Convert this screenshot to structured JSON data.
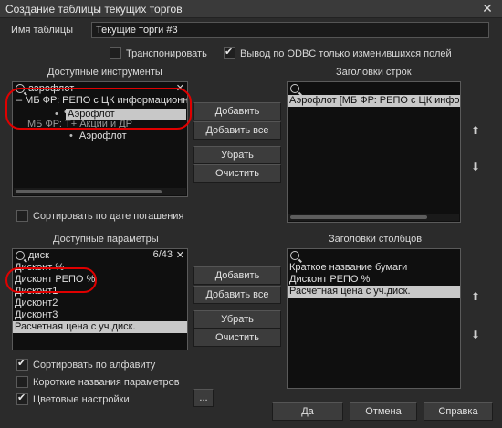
{
  "window": {
    "title": "Создание таблицы текущих торгов",
    "close_glyph": "✕"
  },
  "table_name": {
    "label": "Имя таблицы",
    "value": "Текущие торги #3"
  },
  "options": {
    "transpose": {
      "label": "Транспонировать",
      "checked": false
    },
    "odbc": {
      "label": "Вывод по ODBC только изменившихся  полей",
      "checked": true
    }
  },
  "instruments": {
    "title": "Доступные инструменты",
    "search_value": "аэрофлот",
    "search_clear": "✕",
    "tree": [
      {
        "text": "– МБ ФР: РЕПО с ЦК информационный",
        "level": 0,
        "selected": false
      },
      {
        "text": "Аэрофлот",
        "level": 1,
        "selected": true
      },
      {
        "text": "МБ ФР: Т+ Акции и ДР",
        "level": 0,
        "selected": false
      },
      {
        "text": "Аэрофлот",
        "level": 1,
        "selected": false
      }
    ],
    "sort_by_maturity": {
      "label": "Сортировать по дате погашения",
      "checked": false
    }
  },
  "row_headers": {
    "title": "Заголовки строк",
    "items": [
      {
        "text": "Аэрофлот [МБ ФР: РЕПО с ЦК информа",
        "selected": true
      }
    ]
  },
  "instrument_buttons": {
    "add": "Добавить",
    "add_all": "Добавить все",
    "remove": "Убрать",
    "clear": "Очистить"
  },
  "parameters": {
    "title": "Доступные параметры",
    "search_value": "диск",
    "count": "6/43",
    "search_clear": "✕",
    "items": [
      {
        "text": "Дисконт %",
        "selected": false
      },
      {
        "text": "Дисконт РЕПО %",
        "selected": false
      },
      {
        "text": "Дисконт1",
        "selected": false
      },
      {
        "text": "Дисконт2",
        "selected": false
      },
      {
        "text": "Дисконт3",
        "selected": false
      },
      {
        "text": "Расчетная цена с уч.диск.",
        "selected": true
      }
    ]
  },
  "column_headers": {
    "title": "Заголовки столбцов",
    "items": [
      {
        "text": "Краткое название бумаги",
        "selected": false
      },
      {
        "text": "Дисконт РЕПО %",
        "selected": false
      },
      {
        "text": "Расчетная цена с уч.диск.",
        "selected": true
      }
    ]
  },
  "param_buttons": {
    "add": "Добавить",
    "add_all": "Добавить все",
    "remove": "Убрать",
    "clear": "Очистить"
  },
  "bottom_options": {
    "sort_alpha": {
      "label": "Сортировать по алфавиту",
      "checked": true
    },
    "short_names": {
      "label": "Короткие названия параметров",
      "checked": false
    },
    "color_settings": {
      "label": "Цветовые настройки",
      "checked": true
    },
    "more_button": "..."
  },
  "footer": {
    "ok": "Да",
    "cancel": "Отмена",
    "help": "Справка"
  },
  "arrows": {
    "up": "⬆",
    "down": "⬇"
  },
  "colors": {
    "annotation_ring": "#e00000",
    "selection": "#c8c8c8",
    "background": "#2b2b2b"
  }
}
